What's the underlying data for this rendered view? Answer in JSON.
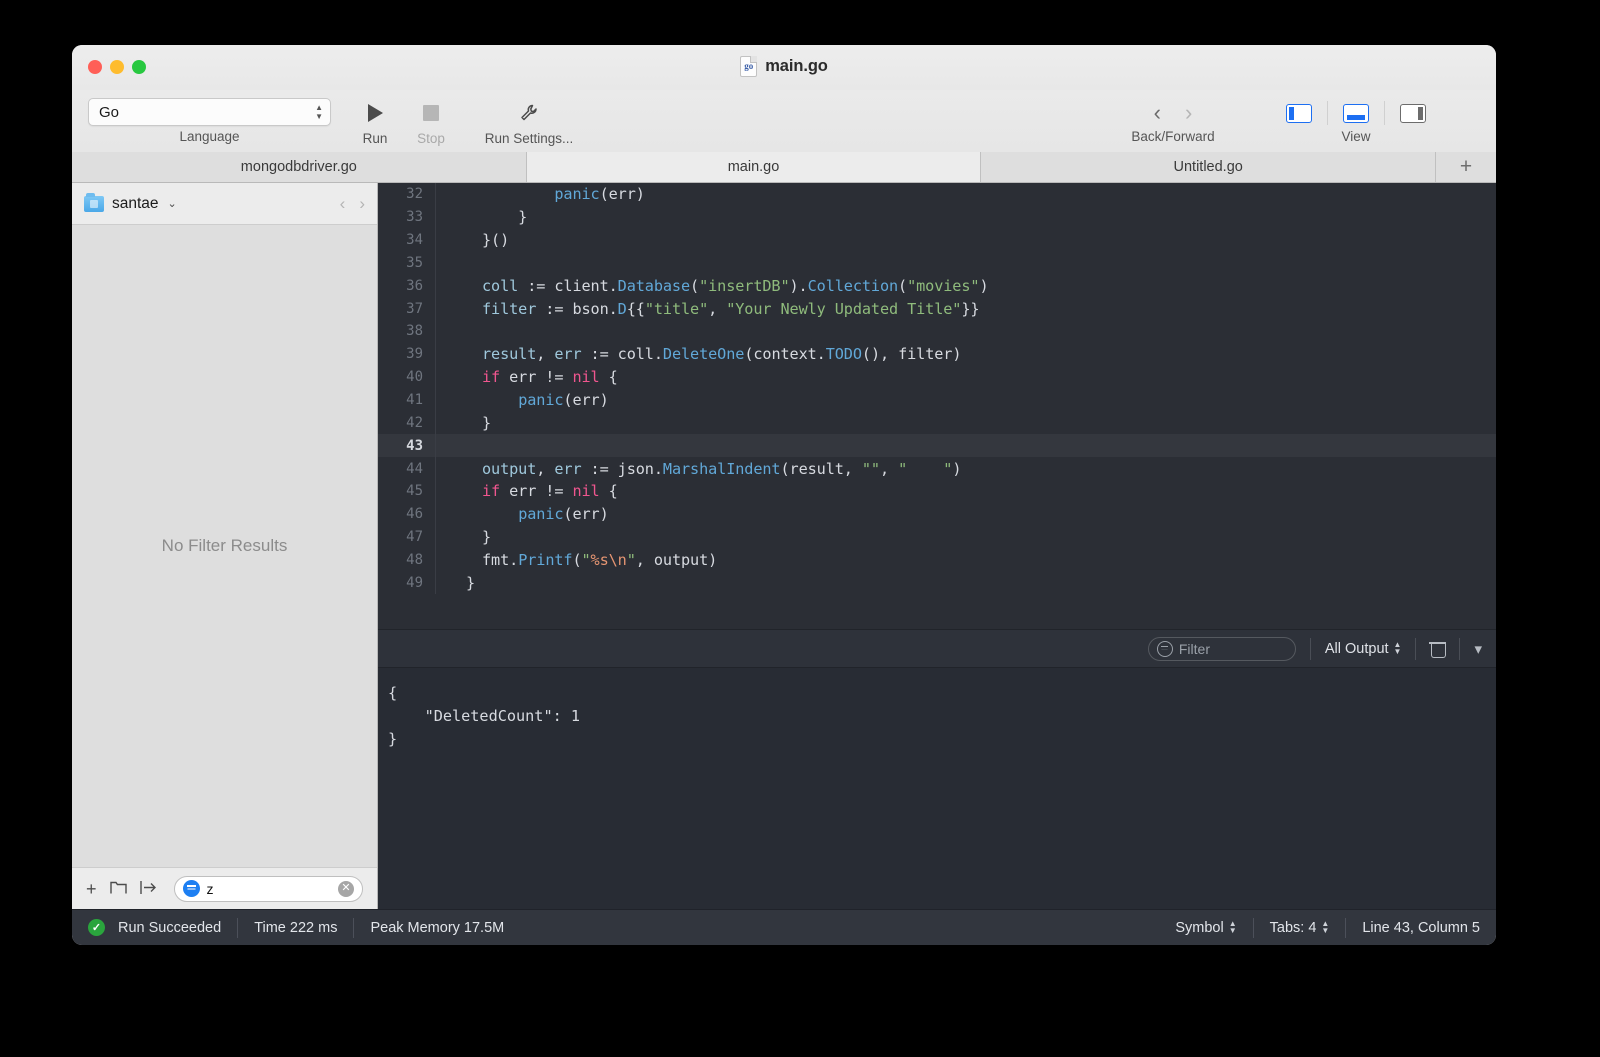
{
  "window": {
    "title": "main.go",
    "doc_icon_label": "go",
    "traffic_lights": [
      "close",
      "minimize",
      "zoom"
    ]
  },
  "toolbar": {
    "language": {
      "value": "Go",
      "label": "Language"
    },
    "run": {
      "label": "Run",
      "icon": "play-icon"
    },
    "stop": {
      "label": "Stop",
      "icon": "stop-icon",
      "enabled": false
    },
    "run_settings": {
      "label": "Run Settings...",
      "icon": "wrench-icon"
    },
    "navigation": {
      "label": "Back/Forward",
      "back": "‹",
      "forward": "›"
    },
    "view": {
      "label": "View",
      "left_panel": {
        "name": "left-panel-toggle",
        "active": true
      },
      "bottom_panel": {
        "name": "bottom-panel-toggle",
        "active": true
      },
      "right_panel": {
        "name": "right-panel-toggle",
        "active": false
      }
    }
  },
  "tabs": {
    "items": [
      {
        "label": "mongodbdriver.go",
        "active": false
      },
      {
        "label": "main.go",
        "active": true
      },
      {
        "label": "Untitled.go",
        "active": false
      }
    ],
    "add_label": "+"
  },
  "sidebar": {
    "project_name": "santae",
    "chevron": "⌄",
    "nav_back": "‹",
    "nav_forward": "›",
    "empty_message": "No Filter Results",
    "footer": {
      "add": "+",
      "new_folder": "☐",
      "import": "→",
      "filter_value": "z",
      "clear": "✕"
    }
  },
  "editor": {
    "active_line": 43,
    "first_line": 32,
    "lines": [
      {
        "n": 32,
        "tokens": [
          {
            "t": "        ",
            "c": "pl"
          },
          {
            "t": "panic",
            "c": "fn"
          },
          {
            "t": "(err)",
            "c": "pl"
          }
        ]
      },
      {
        "n": 33,
        "tokens": [
          {
            "t": "    }",
            "c": "pl"
          }
        ]
      },
      {
        "n": 34,
        "tokens": [
          {
            "t": "}()",
            "c": "pl"
          }
        ]
      },
      {
        "n": 35,
        "tokens": [
          {
            "t": "",
            "c": "pl"
          }
        ]
      },
      {
        "n": 36,
        "tokens": [
          {
            "t": "coll",
            "c": "var"
          },
          {
            "t": " := client.",
            "c": "pl"
          },
          {
            "t": "Database",
            "c": "fn"
          },
          {
            "t": "(",
            "c": "pl"
          },
          {
            "t": "\"insertDB\"",
            "c": "str"
          },
          {
            "t": ").",
            "c": "pl"
          },
          {
            "t": "Collection",
            "c": "fn"
          },
          {
            "t": "(",
            "c": "pl"
          },
          {
            "t": "\"movies\"",
            "c": "str"
          },
          {
            "t": ")",
            "c": "pl"
          }
        ]
      },
      {
        "n": 37,
        "tokens": [
          {
            "t": "filter",
            "c": "var"
          },
          {
            "t": " := bson.",
            "c": "pl"
          },
          {
            "t": "D",
            "c": "fn"
          },
          {
            "t": "{{",
            "c": "pl"
          },
          {
            "t": "\"title\"",
            "c": "str"
          },
          {
            "t": ", ",
            "c": "pl"
          },
          {
            "t": "\"Your Newly Updated Title\"",
            "c": "str"
          },
          {
            "t": "}}",
            "c": "pl"
          }
        ]
      },
      {
        "n": 38,
        "tokens": [
          {
            "t": "",
            "c": "pl"
          }
        ]
      },
      {
        "n": 39,
        "tokens": [
          {
            "t": "result",
            "c": "var"
          },
          {
            "t": ", ",
            "c": "pl"
          },
          {
            "t": "err",
            "c": "var"
          },
          {
            "t": " := coll.",
            "c": "pl"
          },
          {
            "t": "DeleteOne",
            "c": "fn"
          },
          {
            "t": "(context.",
            "c": "pl"
          },
          {
            "t": "TODO",
            "c": "fn"
          },
          {
            "t": "(), filter)",
            "c": "pl"
          }
        ]
      },
      {
        "n": 40,
        "tokens": [
          {
            "t": "if",
            "c": "kw"
          },
          {
            "t": " err != ",
            "c": "pl"
          },
          {
            "t": "nil",
            "c": "kw"
          },
          {
            "t": " {",
            "c": "pl"
          }
        ]
      },
      {
        "n": 41,
        "tokens": [
          {
            "t": "    ",
            "c": "pl"
          },
          {
            "t": "panic",
            "c": "fn"
          },
          {
            "t": "(err)",
            "c": "pl"
          }
        ]
      },
      {
        "n": 42,
        "tokens": [
          {
            "t": "}",
            "c": "pl"
          }
        ]
      },
      {
        "n": 43,
        "tokens": [
          {
            "t": "",
            "c": "pl"
          }
        ]
      },
      {
        "n": 44,
        "tokens": [
          {
            "t": "output",
            "c": "var"
          },
          {
            "t": ", ",
            "c": "pl"
          },
          {
            "t": "err",
            "c": "var"
          },
          {
            "t": " := json.",
            "c": "pl"
          },
          {
            "t": "MarshalIndent",
            "c": "fn"
          },
          {
            "t": "(result, ",
            "c": "pl"
          },
          {
            "t": "\"\"",
            "c": "str"
          },
          {
            "t": ", ",
            "c": "pl"
          },
          {
            "t": "\"    \"",
            "c": "str"
          },
          {
            "t": ")",
            "c": "pl"
          }
        ]
      },
      {
        "n": 45,
        "tokens": [
          {
            "t": "if",
            "c": "kw"
          },
          {
            "t": " err != ",
            "c": "pl"
          },
          {
            "t": "nil",
            "c": "kw"
          },
          {
            "t": " {",
            "c": "pl"
          }
        ]
      },
      {
        "n": 46,
        "tokens": [
          {
            "t": "    ",
            "c": "pl"
          },
          {
            "t": "panic",
            "c": "fn"
          },
          {
            "t": "(err)",
            "c": "pl"
          }
        ]
      },
      {
        "n": 47,
        "tokens": [
          {
            "t": "}",
            "c": "pl"
          }
        ]
      },
      {
        "n": 48,
        "tokens": [
          {
            "t": "fmt.",
            "c": "pl"
          },
          {
            "t": "Printf",
            "c": "fn"
          },
          {
            "t": "(",
            "c": "pl"
          },
          {
            "t": "\"",
            "c": "str"
          },
          {
            "t": "%s\\n",
            "c": "esc"
          },
          {
            "t": "\"",
            "c": "str"
          },
          {
            "t": ", output)",
            "c": "pl"
          }
        ]
      },
      {
        "n": 49,
        "tokens": [
          {
            "t": "}",
            "c": "pl"
          },
          {
            "t": "",
            "c": "pl"
          }
        ],
        "dedent": true
      }
    ]
  },
  "console": {
    "filter_placeholder": "Filter",
    "output_scope": "All Output",
    "trash_icon": "trash-icon",
    "collapse_icon": "chevron-down-icon",
    "output": "{\n    \"DeletedCount\": 1\n}"
  },
  "status": {
    "run_result": "Run Succeeded",
    "check": "✓",
    "time": "Time 222 ms",
    "memory": "Peak Memory 17.5M",
    "symbol": "Symbol",
    "tabs": "Tabs: 4",
    "cursor": "Line 43, Column 5"
  },
  "colors": {
    "accent_blue": "#1d7ff2",
    "success_green": "#2aa53d",
    "editor_bg": "#2b2e35",
    "console_bg": "#282c34",
    "keyword": "#f0568f",
    "function": "#61a8d8",
    "string": "#8fbb7c",
    "variable": "#9fc8dc"
  }
}
